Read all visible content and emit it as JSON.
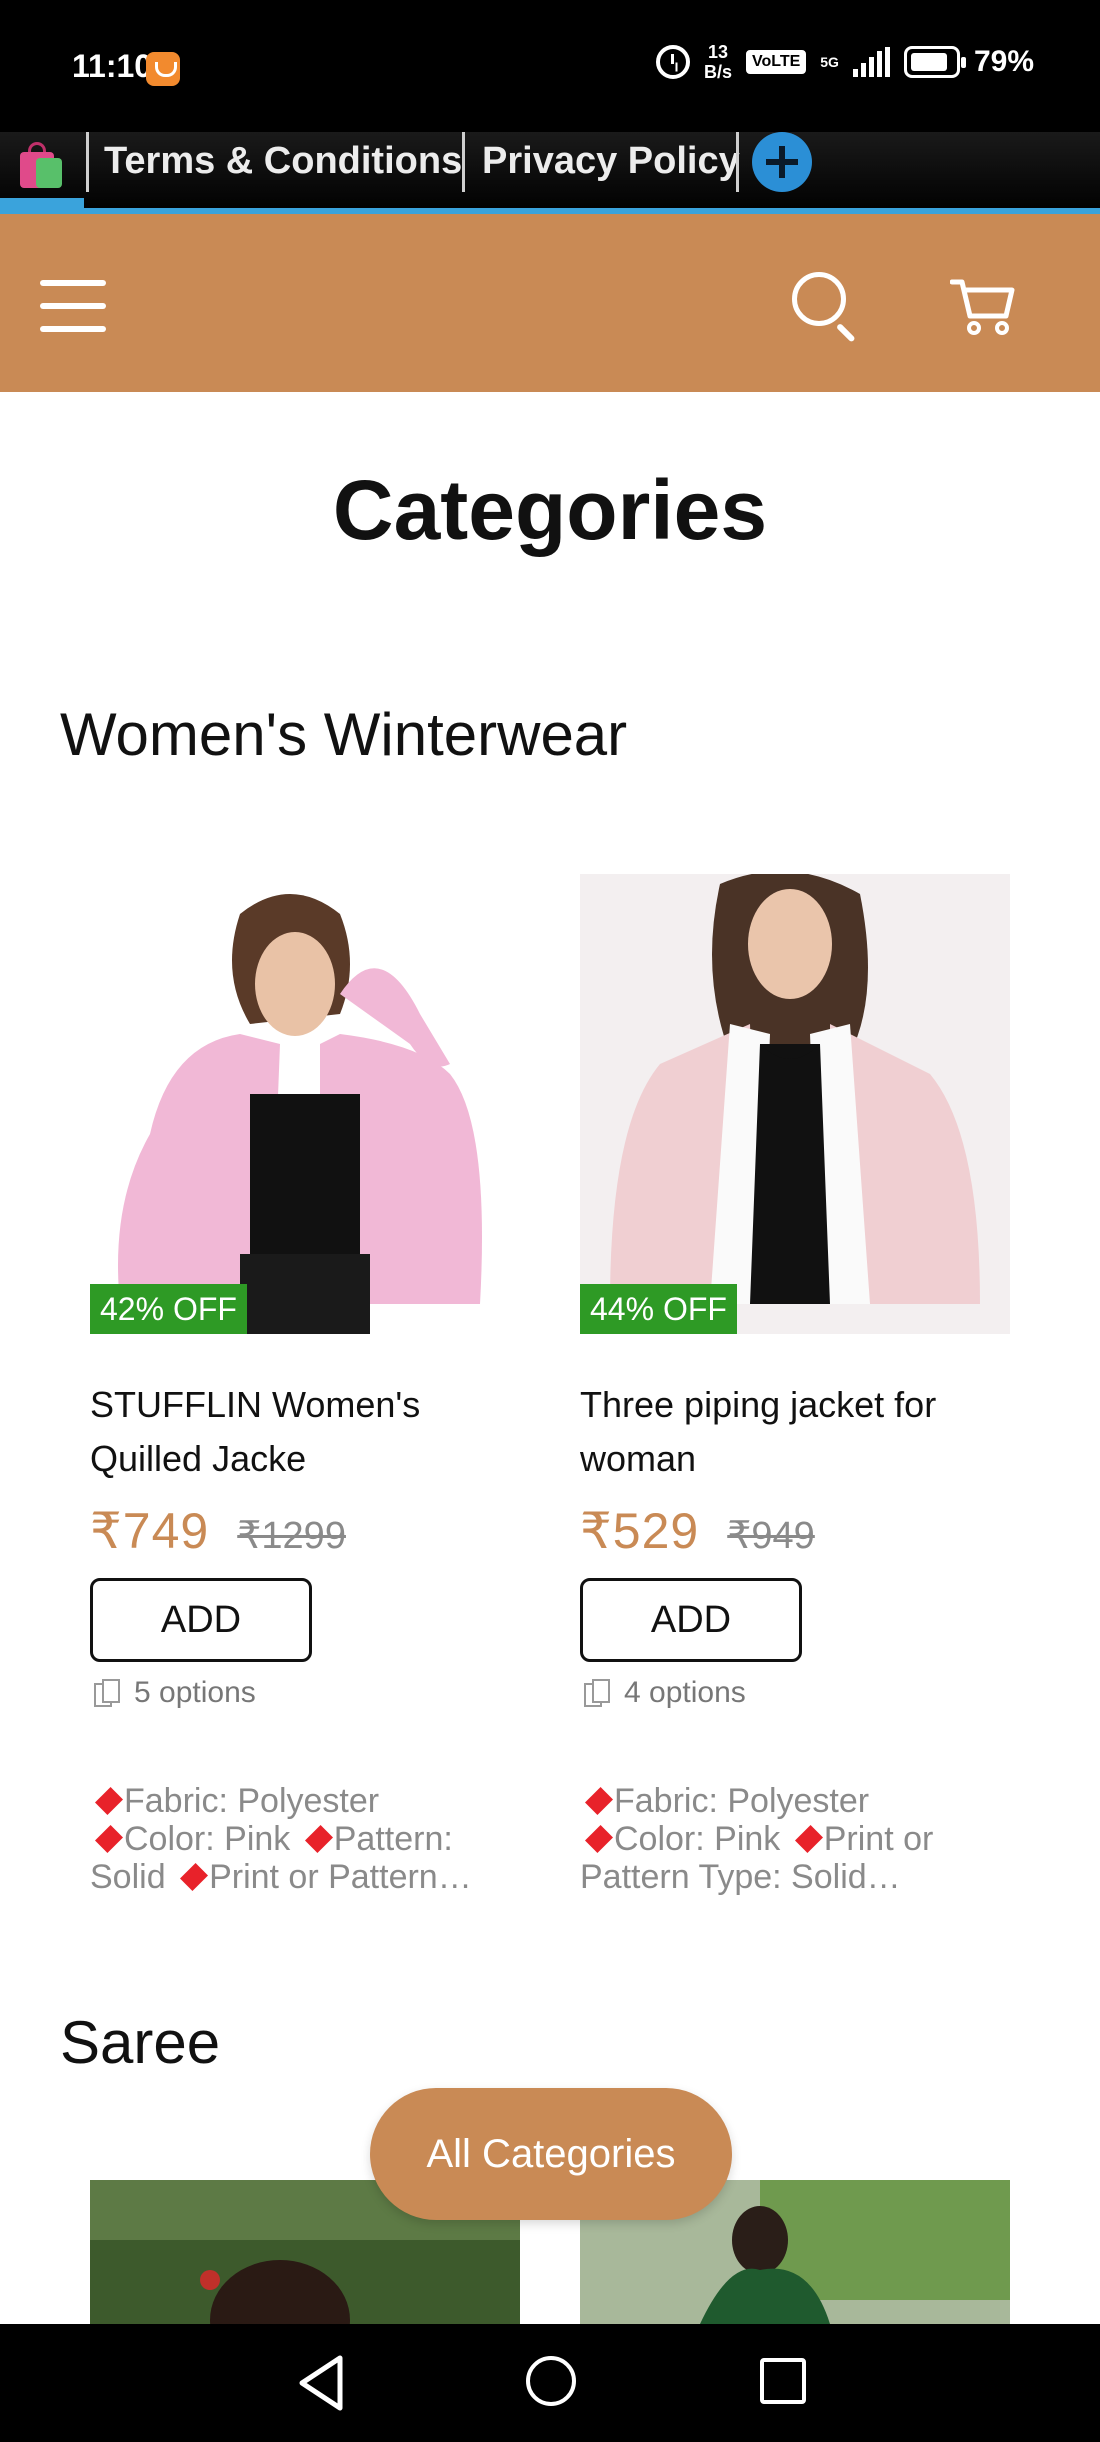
{
  "status_bar": {
    "time": "11:10",
    "data_speed_value": "13",
    "data_speed_unit": "B/s",
    "volte": "VoLTE",
    "network": "5G",
    "battery": "79%"
  },
  "tab_strip": {
    "terms_label": "Terms & Conditions",
    "privacy_label": "Privacy Policy"
  },
  "header": {
    "background_color": "#c98a55"
  },
  "page_title": "Categories",
  "sections": [
    {
      "title": "Women's Winterwear",
      "products": [
        {
          "discount": "42% OFF",
          "name": "STUFFLIN Women's Quilled Jacke",
          "price": "₹749",
          "mrp": "₹1299",
          "add_label": "ADD",
          "options": "5 options",
          "desc": [
            {
              "text": "Fabric: Polyester"
            },
            {
              "text": "Color: Pink"
            },
            {
              "text": "Pattern: Solid"
            },
            {
              "text": "Print or Pattern…"
            }
          ]
        },
        {
          "discount": "44% OFF",
          "name": "Three piping jacket for woman",
          "price": "₹529",
          "mrp": "₹949",
          "add_label": "ADD",
          "options": "4 options",
          "desc": [
            {
              "text": "Fabric: Polyester"
            },
            {
              "text": "Color: Pink"
            },
            {
              "text": "Print or Pattern Type: Solid…"
            }
          ]
        }
      ]
    },
    {
      "title": "Saree"
    }
  ],
  "fab_label": "All Categories",
  "icons": {
    "menu": "hamburger-menu-icon",
    "search": "search-icon",
    "cart": "cart-icon",
    "options": "options-icon",
    "bullet": "red-diamond-icon"
  }
}
